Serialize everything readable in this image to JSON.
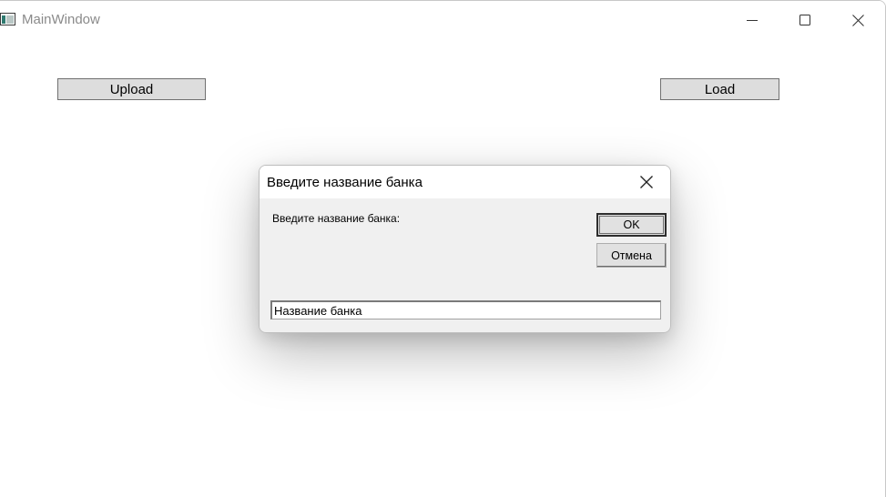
{
  "window": {
    "title": "MainWindow",
    "controls": {
      "minimize_icon": "minimize-icon",
      "maximize_icon": "maximize-icon",
      "close_icon": "close-icon"
    }
  },
  "main": {
    "upload_label": "Upload",
    "load_label": "Load"
  },
  "dialog": {
    "title": "Введите название банка",
    "prompt": "Введите название банка:",
    "ok_label": "OK",
    "cancel_label": "Отмена",
    "input_value": "Название банка",
    "close_icon": "close-icon"
  },
  "colors": {
    "button_face": "#dddddd",
    "dialog_background": "#f0f0f0",
    "title_text": "#8a8a8a"
  }
}
